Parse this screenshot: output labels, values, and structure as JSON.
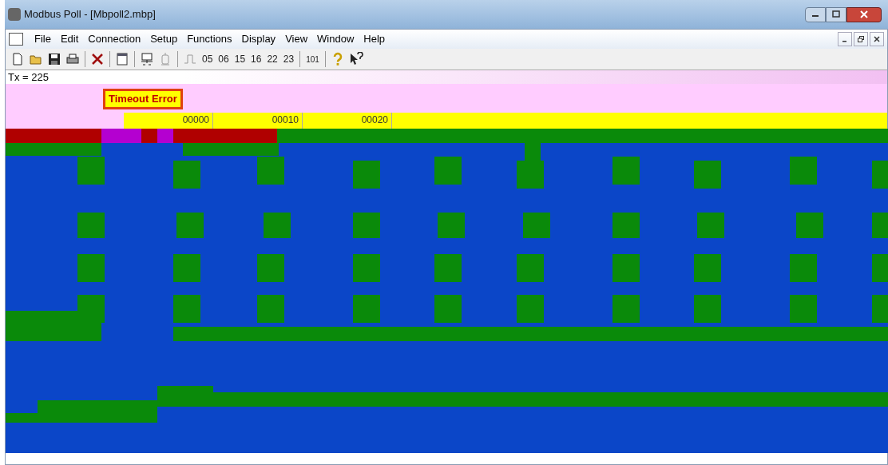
{
  "window": {
    "title": "Modbus Poll - [Mbpoll2.mbp]"
  },
  "menu": [
    {
      "label": "File"
    },
    {
      "label": "Edit"
    },
    {
      "label": "Connection"
    },
    {
      "label": "Setup"
    },
    {
      "label": "Functions"
    },
    {
      "label": "Display"
    },
    {
      "label": "View"
    },
    {
      "label": "Window"
    },
    {
      "label": "Help"
    }
  ],
  "toolbar": [
    {
      "kind": "new"
    },
    {
      "kind": "open"
    },
    {
      "kind": "save"
    },
    {
      "kind": "print"
    },
    {
      "kind": "sep"
    },
    {
      "kind": "disconnect"
    },
    {
      "kind": "sep"
    },
    {
      "kind": "window"
    },
    {
      "kind": "sep"
    },
    {
      "kind": "connect"
    },
    {
      "kind": "device",
      "disabled": true
    },
    {
      "kind": "sep"
    },
    {
      "kind": "pulse",
      "disabled": true
    },
    {
      "kind": "text",
      "label": "05"
    },
    {
      "kind": "text",
      "label": "06"
    },
    {
      "kind": "text",
      "label": "15"
    },
    {
      "kind": "text",
      "label": "16"
    },
    {
      "kind": "text",
      "label": "22"
    },
    {
      "kind": "text",
      "label": "23"
    },
    {
      "kind": "sep"
    },
    {
      "kind": "small",
      "label": "101"
    },
    {
      "kind": "sep"
    },
    {
      "kind": "help"
    },
    {
      "kind": "whatsthis"
    }
  ],
  "status": {
    "text": "Tx = 225"
  },
  "error": {
    "text": "Timeout Error"
  },
  "table": {
    "columns": [
      "00000",
      "00010",
      "00020"
    ]
  }
}
